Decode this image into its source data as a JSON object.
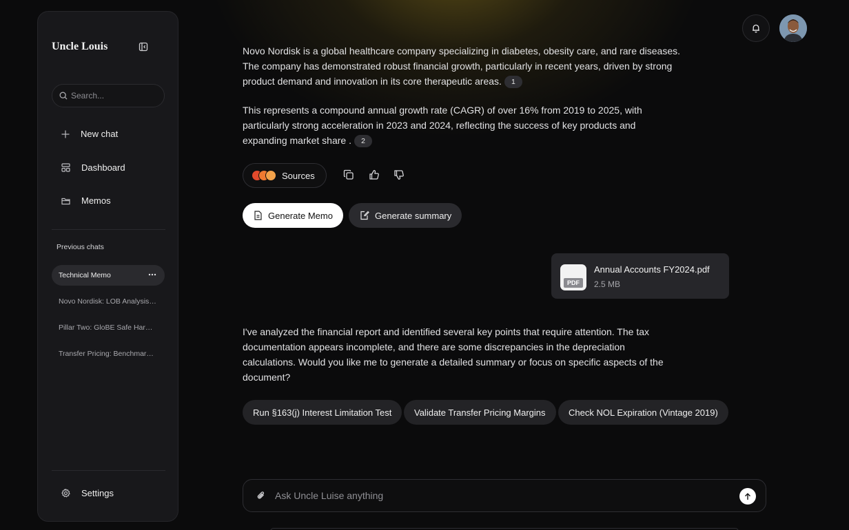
{
  "sidebar": {
    "brand": "Uncle Louis",
    "search_placeholder": "Search...",
    "nav": [
      {
        "label": "New chat",
        "icon": "plus-icon"
      },
      {
        "label": "Dashboard",
        "icon": "dashboard-icon"
      },
      {
        "label": "Memos",
        "icon": "folder-icon"
      }
    ],
    "previous_label": "Previous chats",
    "chats": [
      {
        "label": "Technical Memo",
        "active": true
      },
      {
        "label": "Novo Nordisk: LOB Analysis (U..."
      },
      {
        "label": "Pillar Two: GloBE Safe Harbours"
      },
      {
        "label": "Transfer Pricing: Benchmarkin..."
      }
    ],
    "settings_label": "Settings"
  },
  "message": {
    "para1": "Novo Nordisk is a global healthcare company specializing in diabetes, obesity care, and rare diseases. The company has demonstrated robust financial growth, particularly in recent years, driven by strong product demand and innovation in its core therapeutic areas.",
    "cite1": "1",
    "para2": "This represents a compound annual growth rate (CAGR) of over 16% from 2019 to 2025, with particularly strong acceleration in 2023 and 2024, reflecting the success of key products and expanding market share .",
    "cite2": "2",
    "sources_label": "Sources",
    "generate_memo": "Generate Memo",
    "generate_summary": "Generate summary"
  },
  "attachment": {
    "name": "Annual Accounts FY2024.pdf",
    "size": "2.5 MB",
    "type": "PDF"
  },
  "reply": "I've analyzed the financial report and identified several key points that require attention. The tax documentation appears incomplete, and there are some discrepancies in the depreciation calculations. Would you like me to generate a detailed summary or focus on specific aspects of the document?",
  "suggestions": [
    "Run §163(j) Interest Limitation Test",
    "Validate Transfer Pricing Margins",
    "Check NOL Expiration (Vintage 2019)"
  ],
  "composer": {
    "placeholder": "Ask Uncle Luise anything"
  },
  "colors": {
    "background": "#0b0b0c",
    "sidebar": "#18181b",
    "accent_glow": "#967d1e"
  }
}
